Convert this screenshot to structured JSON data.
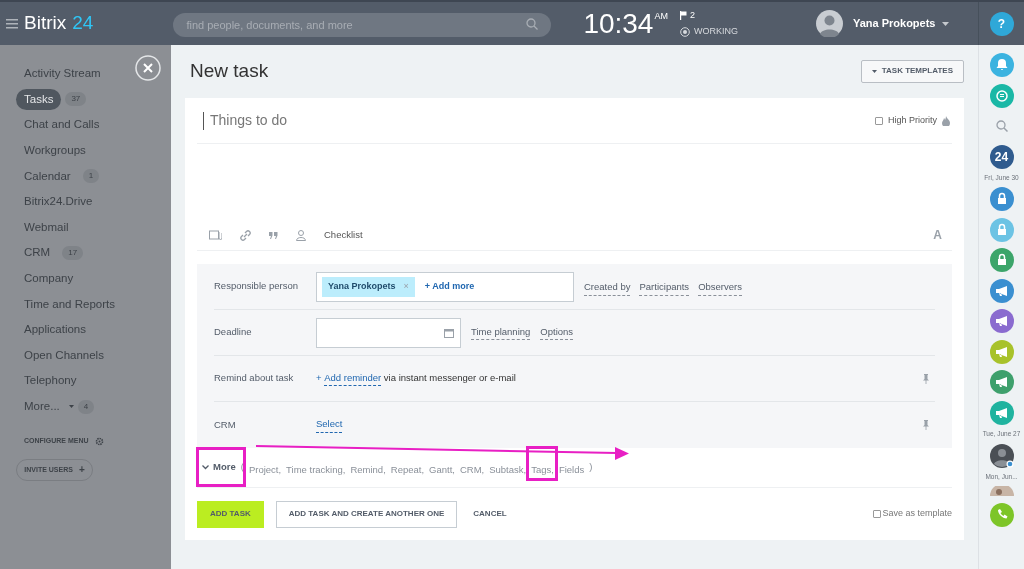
{
  "header": {
    "logo_name": "Bitrix",
    "logo_number": "24",
    "search": {
      "placeholder": "find people, documents, and more"
    },
    "time": "10:34",
    "ampm": "AM",
    "flag_count": "2",
    "work_status": "WORKING",
    "user_name": "Yana Prokopets",
    "help": "?"
  },
  "sidebar": {
    "items": [
      {
        "kind": "link",
        "label": "Activity Stream",
        "selected": false
      },
      {
        "kind": "link",
        "label": "Tasks",
        "badge": "37",
        "selected": true
      },
      {
        "kind": "link",
        "label": "Chat and Calls",
        "selected": false
      },
      {
        "kind": "link",
        "label": "Workgroups",
        "selected": false
      },
      {
        "kind": "link",
        "label": "Calendar",
        "badge": "1",
        "selected": false
      },
      {
        "kind": "link",
        "label": "Bitrix24.Drive",
        "selected": false
      },
      {
        "kind": "link",
        "label": "Webmail",
        "selected": false
      },
      {
        "kind": "link",
        "label": "CRM",
        "badge": "17",
        "selected": false
      },
      {
        "kind": "link",
        "label": "Company",
        "selected": false
      },
      {
        "kind": "link",
        "label": "Time and Reports",
        "selected": false
      },
      {
        "kind": "link",
        "label": "Applications",
        "selected": false
      },
      {
        "kind": "link",
        "label": "Open Channels",
        "selected": false
      },
      {
        "kind": "link",
        "label": "Telephony",
        "selected": false
      },
      {
        "kind": "dropdown",
        "label": "More...",
        "badge": "4",
        "selected": false
      }
    ],
    "configure": "CONFIGURE MENU",
    "invite": "INVITE USERS",
    "invite_plus": "+"
  },
  "page": {
    "title": "New task",
    "templates_button": "TASK TEMPLATES"
  },
  "form": {
    "title_placeholder": "Things to do",
    "high_priority": {
      "label": "High Priority",
      "checked": false
    },
    "toolbar_checklist": "Checklist",
    "font_glyph": "A",
    "rows": [
      {
        "kind": "people",
        "label": "Responsible person",
        "person": "Yana Prokopets",
        "remove": "×",
        "add_more": "+ Add more",
        "links": [
          "Created by",
          "Participants",
          "Observers"
        ]
      },
      {
        "kind": "date",
        "label": "Deadline",
        "links": [
          "Time planning",
          "Options"
        ]
      },
      {
        "kind": "reminder",
        "label": "Remind about task",
        "prefix": "+ ",
        "link": "Add reminder",
        "suffix": " via instant messenger or e-mail"
      },
      {
        "kind": "select",
        "label": "CRM",
        "link": "Select"
      }
    ],
    "more": {
      "label": "More",
      "open": "(",
      "items": [
        "Project,",
        "Time tracking,",
        "Remind,",
        "Repeat,",
        "Gantt,",
        "CRM,",
        "Subtask,",
        "Tags,",
        "Fields"
      ],
      "close": ")"
    },
    "buttons": {
      "add": "ADD TASK",
      "add_another": "ADD TASK AND CREATE ANOTHER ONE",
      "cancel": "CANCEL"
    },
    "save_template": {
      "label": "Save as template",
      "checked": false
    }
  },
  "rail": [
    {
      "kind": "bell",
      "color": "#3bb3e0"
    },
    {
      "kind": "chat",
      "color": "#1ab8a6"
    },
    {
      "kind": "search"
    },
    {
      "kind": "app",
      "color": "#2f5b8e",
      "text": "24"
    },
    {
      "kind": "date",
      "text": "Fri, June 30"
    },
    {
      "kind": "lock",
      "color": "#3a8fd0"
    },
    {
      "kind": "lock",
      "color": "#6cc3e4"
    },
    {
      "kind": "lock",
      "color": "#3ca56a"
    },
    {
      "kind": "megaphone",
      "color": "#3a8fd0"
    },
    {
      "kind": "megaphone",
      "color": "#8a6bcf"
    },
    {
      "kind": "megaphone",
      "color": "#a8c22a"
    },
    {
      "kind": "megaphone",
      "color": "#3ea06c"
    },
    {
      "kind": "megaphone",
      "color": "#1fb39f"
    },
    {
      "kind": "date",
      "text": "Tue, June 27"
    },
    {
      "kind": "avatar"
    },
    {
      "kind": "date",
      "text": "Mon, Jun..."
    },
    {
      "kind": "avatar_partial"
    },
    {
      "kind": "phone",
      "color": "#7dc528"
    }
  ]
}
